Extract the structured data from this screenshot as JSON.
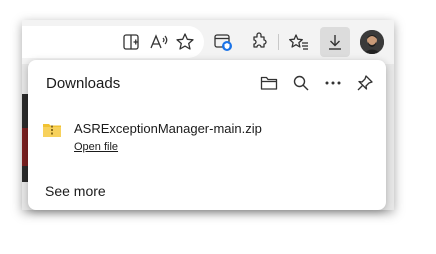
{
  "toolbar": {
    "icons": [
      "split-screen-icon",
      "read-aloud-icon",
      "favorite-star-icon",
      "browser-essentials-icon",
      "extensions-icon",
      "favorites-icon",
      "downloads-icon",
      "profile-avatar"
    ]
  },
  "downloads_panel": {
    "title": "Downloads",
    "header_icons": [
      "open-folder-icon",
      "search-icon",
      "more-options-icon",
      "pin-icon"
    ],
    "items": [
      {
        "file_name": "ASRExceptionManager-main.zip",
        "action": "Open file",
        "icon": "zip-folder-icon"
      }
    ],
    "see_more": "See more"
  },
  "colors": {
    "toolbar_bg": "#f3f3f3",
    "panel_bg": "#ffffff",
    "accent_blue": "#1a73e8",
    "folder_yellow": "#f1c232"
  }
}
